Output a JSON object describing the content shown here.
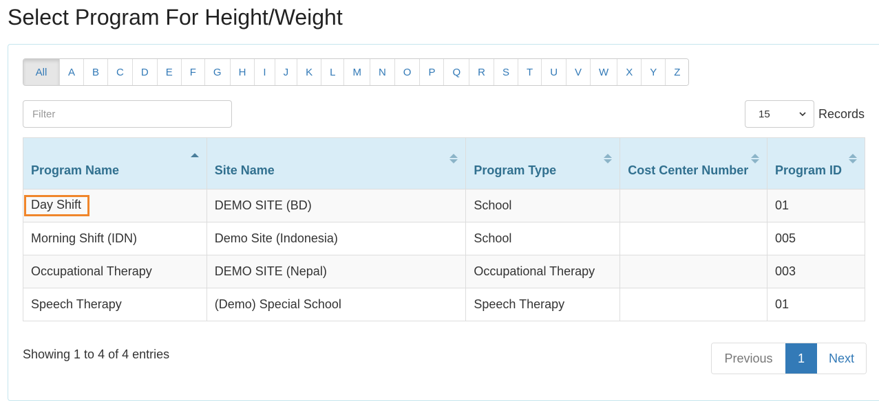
{
  "page": {
    "title": "Select Program For Height/Weight"
  },
  "alphabet": {
    "active": "All",
    "letters": [
      "All",
      "A",
      "B",
      "C",
      "D",
      "E",
      "F",
      "G",
      "H",
      "I",
      "J",
      "K",
      "L",
      "M",
      "N",
      "O",
      "P",
      "Q",
      "R",
      "S",
      "T",
      "U",
      "V",
      "W",
      "X",
      "Y",
      "Z"
    ]
  },
  "filter": {
    "placeholder": "Filter",
    "value": ""
  },
  "records": {
    "selected": "15",
    "label": "Records"
  },
  "table": {
    "columns": [
      {
        "label": "Program Name",
        "sort": "asc"
      },
      {
        "label": "Site Name",
        "sort": "both"
      },
      {
        "label": "Program Type",
        "sort": "both"
      },
      {
        "label": "Cost Center Number",
        "sort": "both"
      },
      {
        "label": "Program ID",
        "sort": "both"
      }
    ],
    "rows": [
      {
        "program_name": "Day Shift",
        "site_name": "DEMO SITE (BD)",
        "program_type": "School",
        "cost_center": "",
        "program_id": "01",
        "highlighted": true
      },
      {
        "program_name": "Morning Shift (IDN)",
        "site_name": "Demo Site (Indonesia)",
        "program_type": "School",
        "cost_center": "",
        "program_id": "005"
      },
      {
        "program_name": "Occupational Therapy",
        "site_name": "DEMO SITE (Nepal)",
        "program_type": "Occupational Therapy",
        "cost_center": "",
        "program_id": "003"
      },
      {
        "program_name": "Speech Therapy",
        "site_name": "(Demo) Special School",
        "program_type": "Speech Therapy",
        "cost_center": "",
        "program_id": "01"
      }
    ]
  },
  "footer": {
    "info": "Showing 1 to 4 of 4 entries",
    "pagination": {
      "previous": "Previous",
      "current": "1",
      "next": "Next"
    }
  },
  "colors": {
    "link": "#337ab7",
    "header_bg": "#d9edf7",
    "header_text": "#31708f",
    "highlight": "#f0862b",
    "active_page": "#337ab7"
  }
}
